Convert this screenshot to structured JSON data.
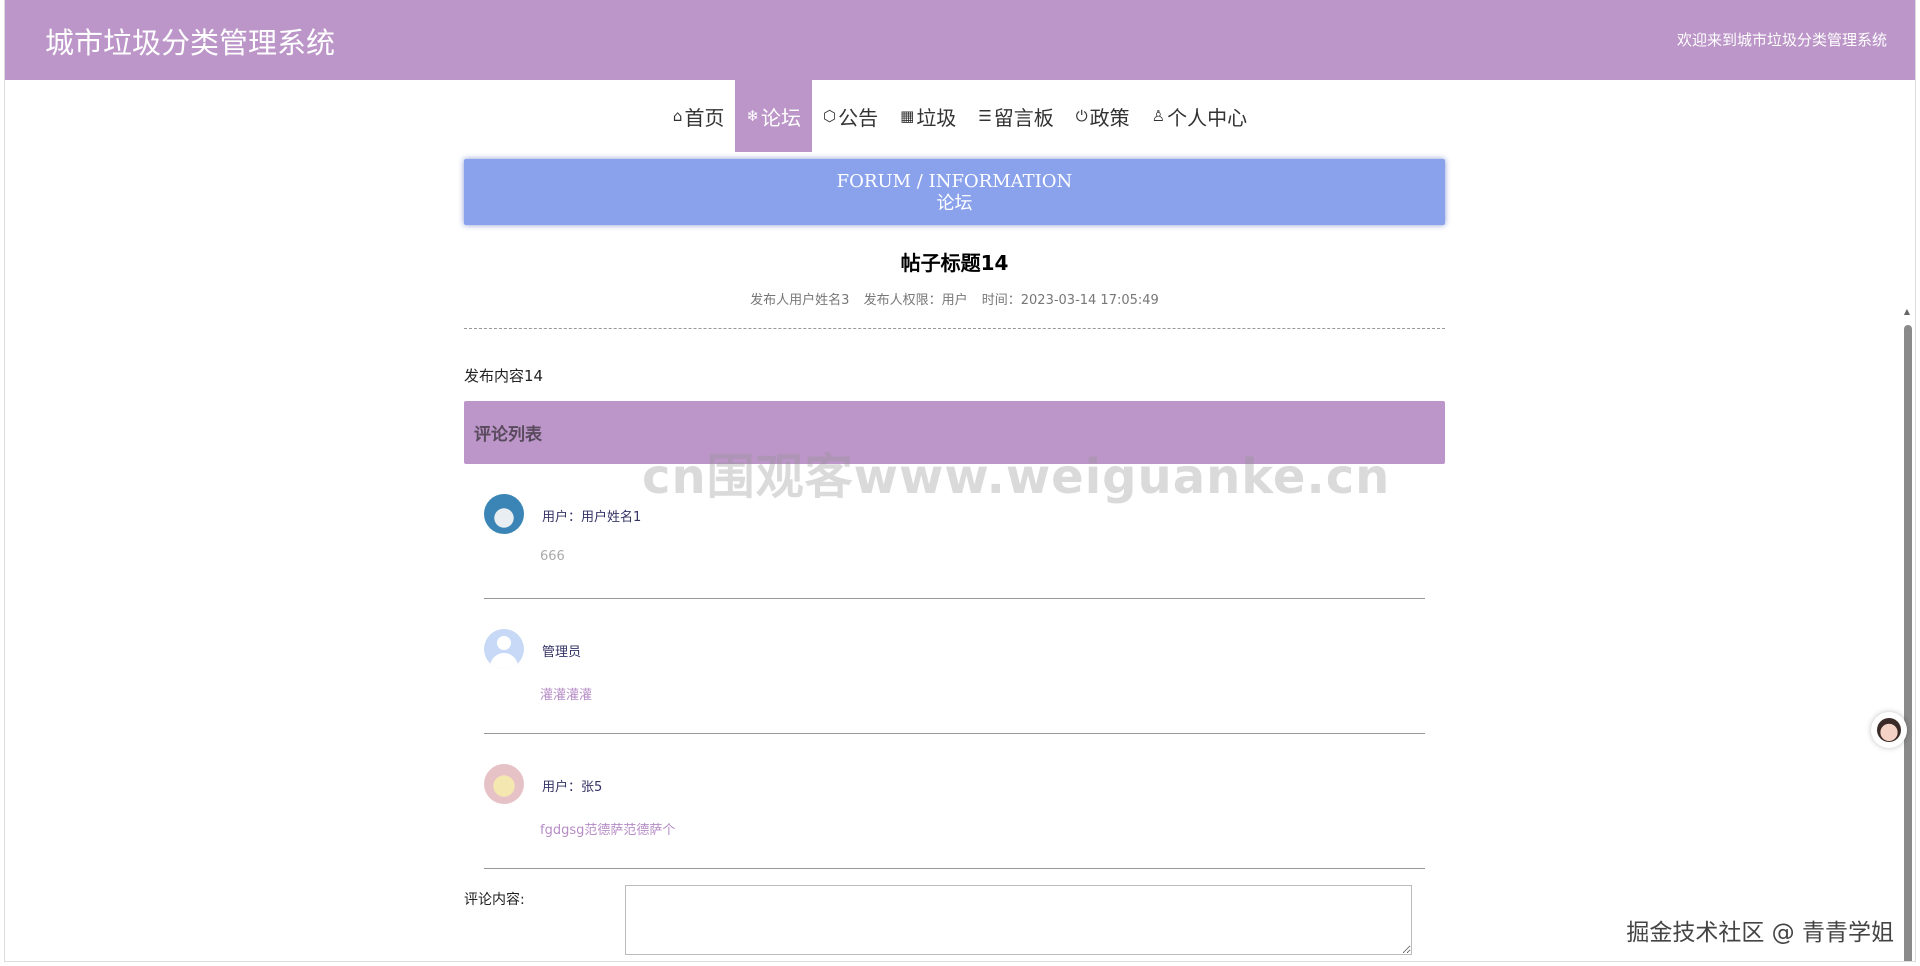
{
  "header": {
    "title": "城市垃圾分类管理系统",
    "welcome": "欢迎来到城市垃圾分类管理系统"
  },
  "nav": {
    "items": [
      {
        "icon": "⌂",
        "label": "首页"
      },
      {
        "icon": "❄",
        "label": "论坛"
      },
      {
        "icon": "⬡",
        "label": "公告"
      },
      {
        "icon": "▦",
        "label": "垃圾"
      },
      {
        "icon": "☰",
        "label": "留言板"
      },
      {
        "icon": "⏻",
        "label": "政策"
      },
      {
        "icon": "♙",
        "label": "个人中心"
      }
    ],
    "active": "论坛"
  },
  "banner": {
    "english": "FORUM / INFORMATION",
    "chinese": "论坛"
  },
  "post": {
    "title": "帖子标题14",
    "author": "发布人用户姓名3",
    "role": "发布人权限：用户",
    "time": "时间：2023-03-14 17:05:49",
    "content": "发布内容14"
  },
  "comments": {
    "header": "评论列表",
    "items": [
      {
        "user": "用户：用户姓名1",
        "text": "666"
      },
      {
        "user": "管理员",
        "text": "灌灌灌灌"
      },
      {
        "user": "用户：张5",
        "text": "fgdgsg范德萨范德萨个"
      }
    ]
  },
  "form": {
    "label": "评论内容:"
  },
  "overlay": {
    "watermark": "cn围观客www.weiguanke.cn",
    "credit": "掘金技术社区 @ 青青学姐"
  },
  "colors": {
    "header_bg": "#bc96c8",
    "banner_bg": "#8aa2ec",
    "comment_header_bg": "#bc96c8"
  }
}
